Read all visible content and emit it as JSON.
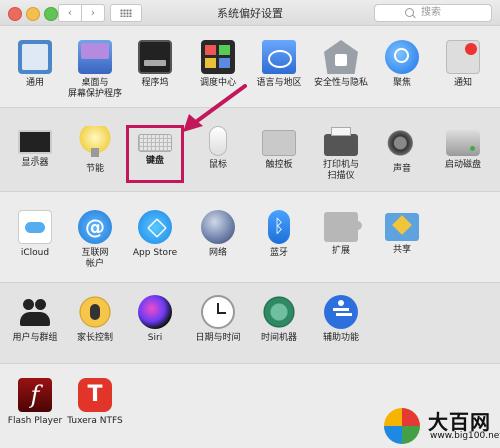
{
  "window": {
    "title": "系统偏好设置",
    "search_placeholder": "搜索"
  },
  "sections": [
    {
      "items": [
        {
          "id": "general",
          "label": "通用",
          "icon": "general-icon"
        },
        {
          "id": "desktop",
          "label": "桌面与\n屏幕保护程序",
          "icon": "desktop-screensaver-icon"
        },
        {
          "id": "dock",
          "label": "程序坞",
          "icon": "dock-icon"
        },
        {
          "id": "mission",
          "label": "调度中心",
          "icon": "mission-control-icon"
        },
        {
          "id": "language",
          "label": "语言与地区",
          "icon": "language-region-icon"
        },
        {
          "id": "security",
          "label": "安全性与隐私",
          "icon": "security-privacy-icon"
        },
        {
          "id": "spotlight",
          "label": "聚焦",
          "icon": "spotlight-icon"
        },
        {
          "id": "notifications",
          "label": "通知",
          "icon": "notifications-icon"
        }
      ]
    },
    {
      "items": [
        {
          "id": "displays",
          "label": "显示器",
          "icon": "displays-icon"
        },
        {
          "id": "energy",
          "label": "节能",
          "icon": "energy-saver-icon"
        },
        {
          "id": "keyboard",
          "label": "键盘",
          "icon": "keyboard-icon"
        },
        {
          "id": "mouse",
          "label": "鼠标",
          "icon": "mouse-icon"
        },
        {
          "id": "trackpad",
          "label": "触控板",
          "icon": "trackpad-icon"
        },
        {
          "id": "printers",
          "label": "打印机与\n扫描仪",
          "icon": "printers-scanners-icon"
        },
        {
          "id": "sound",
          "label": "声音",
          "icon": "sound-icon"
        },
        {
          "id": "startup",
          "label": "启动磁盘",
          "icon": "startup-disk-icon"
        }
      ]
    },
    {
      "items": [
        {
          "id": "icloud",
          "label": "iCloud",
          "icon": "icloud-icon"
        },
        {
          "id": "internet",
          "label": "互联网\n帐户",
          "icon": "internet-accounts-icon"
        },
        {
          "id": "appstore",
          "label": "App Store",
          "icon": "app-store-icon"
        },
        {
          "id": "network",
          "label": "网络",
          "icon": "network-icon"
        },
        {
          "id": "bluetooth",
          "label": "蓝牙",
          "icon": "bluetooth-icon"
        },
        {
          "id": "extensions",
          "label": "扩展",
          "icon": "extensions-icon"
        },
        {
          "id": "sharing",
          "label": "共享",
          "icon": "sharing-icon"
        }
      ]
    },
    {
      "items": [
        {
          "id": "users",
          "label": "用户与群组",
          "icon": "users-groups-icon"
        },
        {
          "id": "parental",
          "label": "家长控制",
          "icon": "parental-controls-icon"
        },
        {
          "id": "siri",
          "label": "Siri",
          "icon": "siri-icon"
        },
        {
          "id": "datetime",
          "label": "日期与时间",
          "icon": "date-time-icon"
        },
        {
          "id": "timemachine",
          "label": "时间机器",
          "icon": "time-machine-icon"
        },
        {
          "id": "accessibility",
          "label": "辅助功能",
          "icon": "accessibility-icon"
        }
      ]
    },
    {
      "items": [
        {
          "id": "flash",
          "label": "Flash Player",
          "icon": "flash-player-icon"
        },
        {
          "id": "tuxera",
          "label": "Tuxera NTFS",
          "icon": "tuxera-ntfs-icon"
        }
      ]
    }
  ],
  "icon_glyphs": {
    "internet": "@",
    "bluetooth": "ᛒ",
    "flash": "f",
    "tuxera": "T"
  },
  "annotation": {
    "highlight_color": "#c2185b"
  },
  "watermark": {
    "text": "大百网",
    "url": "www.big100.net"
  }
}
